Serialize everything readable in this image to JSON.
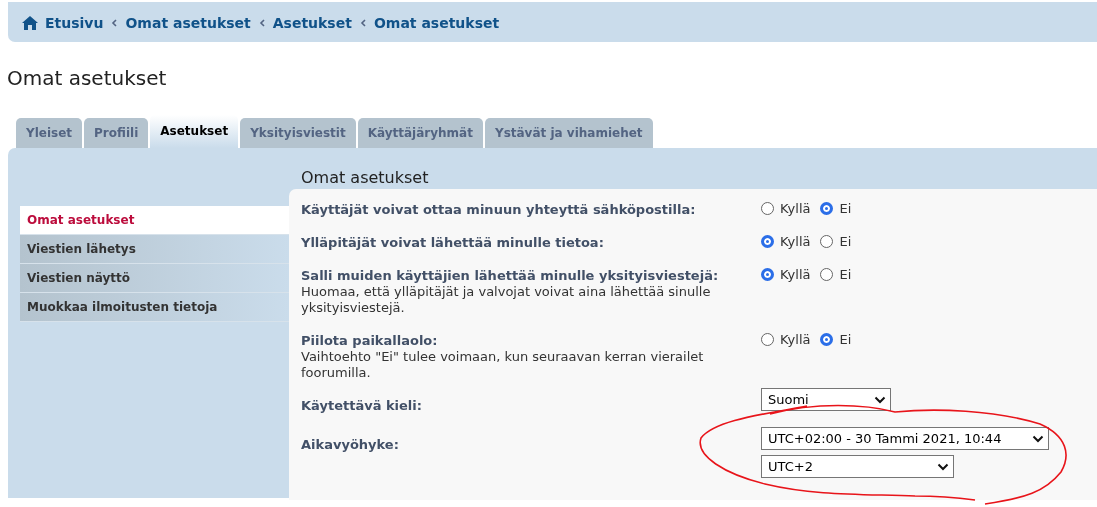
{
  "breadcrumbs": [
    {
      "label": "Etusivu",
      "kind": "home"
    },
    {
      "label": "Omat asetukset"
    },
    {
      "label": "Asetukset"
    },
    {
      "label": "Omat asetukset"
    }
  ],
  "page_title": "Omat asetukset",
  "tabs": [
    {
      "label": "Yleiset",
      "selected": false
    },
    {
      "label": "Profiili",
      "selected": false
    },
    {
      "label": "Asetukset",
      "selected": true
    },
    {
      "label": "Yksityisviestit",
      "selected": false
    },
    {
      "label": "Käyttäjäryhmät",
      "selected": false
    },
    {
      "label": "Ystävät ja vihamiehet",
      "selected": false
    }
  ],
  "sidebar": {
    "items": [
      {
        "label": "Omat asetukset",
        "selected": true
      },
      {
        "label": "Viestien lähetys",
        "selected": false
      },
      {
        "label": "Viestien näyttö",
        "selected": false
      },
      {
        "label": "Muokkaa ilmoitusten tietoja",
        "selected": false
      }
    ]
  },
  "panel": {
    "title": "Omat asetukset",
    "settings": [
      {
        "kind": "radio",
        "label": "Käyttäjät voivat ottaa minuun yhteyttä sähköpostilla:",
        "options": [
          {
            "label": "Kyllä",
            "selected": false
          },
          {
            "label": "Ei",
            "selected": true
          }
        ]
      },
      {
        "kind": "radio",
        "label": "Ylläpitäjät voivat lähettää minulle tietoa:",
        "options": [
          {
            "label": "Kyllä",
            "selected": true
          },
          {
            "label": "Ei",
            "selected": false
          }
        ]
      },
      {
        "kind": "radio",
        "label": "Salli muiden käyttäjien lähettää minulle yksityisviestejä:",
        "note": "Huomaa, että ylläpitäjät ja valvojat voivat aina lähettää sinulle yksityisviestejä.",
        "options": [
          {
            "label": "Kyllä",
            "selected": true
          },
          {
            "label": "Ei",
            "selected": false
          }
        ]
      },
      {
        "kind": "radio",
        "label": "Piilota paikallaolo:",
        "note": "Vaihtoehto \"Ei\" tulee voimaan, kun seuraavan kerran vierailet foorumilla.",
        "options": [
          {
            "label": "Kyllä",
            "selected": false
          },
          {
            "label": "Ei",
            "selected": true
          }
        ]
      },
      {
        "kind": "select",
        "label": "Käytettävä kieli:",
        "selects": [
          {
            "value": "Suomi"
          }
        ]
      },
      {
        "kind": "select",
        "label": "Aikavyöhyke:",
        "selects": [
          {
            "value": "UTC+02:00 - 30 Tammi 2021, 10:44"
          },
          {
            "value": "UTC+2"
          }
        ]
      }
    ]
  },
  "annotations": [
    {
      "kind": "freehand-loop"
    }
  ]
}
